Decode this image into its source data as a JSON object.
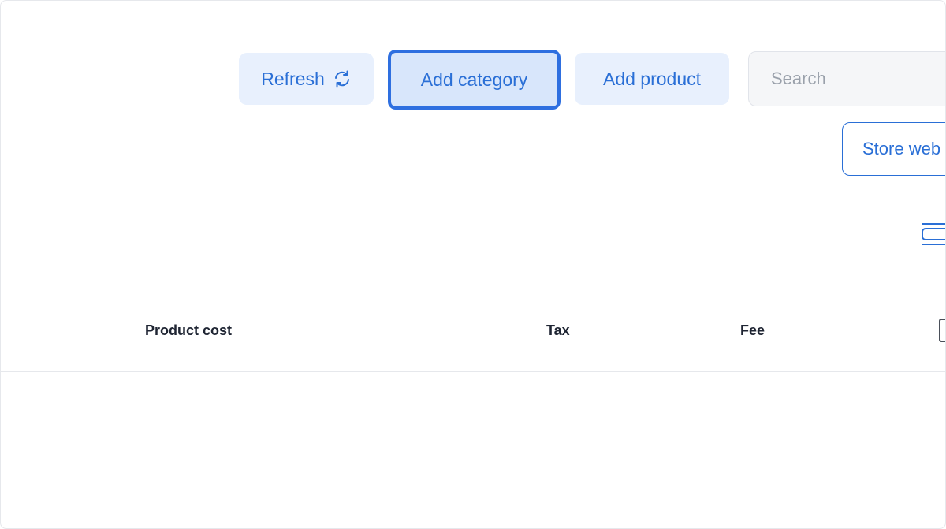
{
  "toolbar": {
    "refresh_label": "Refresh",
    "add_category_label": "Add category",
    "add_product_label": "Add product",
    "search_placeholder": "Search",
    "store_website_label": "Store web"
  },
  "table": {
    "columns": [
      "Product cost",
      "Tax",
      "Fee"
    ]
  },
  "icons": {
    "refresh": "refresh-icon",
    "view_toggle": "card-view-icon"
  },
  "colors": {
    "accent": "#2a6fd6",
    "button_bg": "#e8f0fd",
    "focus_ring": "#2e6fe0"
  }
}
